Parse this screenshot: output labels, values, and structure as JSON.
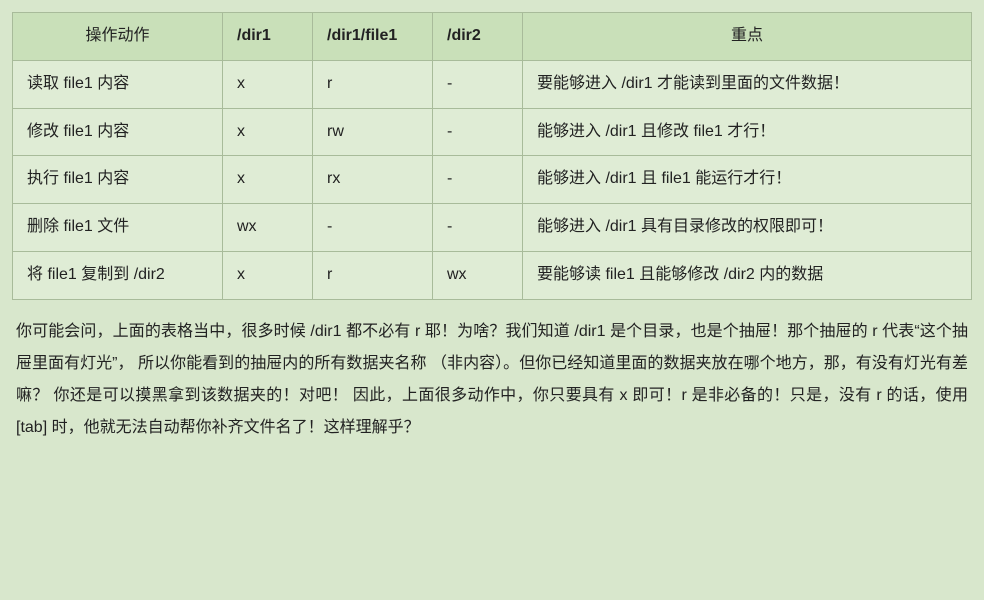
{
  "table": {
    "headers": [
      "操作动作",
      "/dir1",
      "/dir1/file1",
      "/dir2",
      "重点"
    ],
    "rows": [
      {
        "c0": "读取 file1 内容",
        "c1": "x",
        "c2": "r",
        "c3": "-",
        "c4": "要能够进入 /dir1 才能读到里面的文件数据！"
      },
      {
        "c0": "修改 file1 内容",
        "c1": "x",
        "c2": "rw",
        "c3": "-",
        "c4": "能够进入 /dir1 且修改 file1 才行！"
      },
      {
        "c0": "执行 file1 内容",
        "c1": "x",
        "c2": "rx",
        "c3": "-",
        "c4": "能够进入 /dir1 且 file1 能运行才行！"
      },
      {
        "c0": "删除 file1 文件",
        "c1": "wx",
        "c2": "-",
        "c3": "-",
        "c4": "能够进入 /dir1 具有目录修改的权限即可！"
      },
      {
        "c0": "将 file1 复制到 /dir2",
        "c1": "x",
        "c2": "r",
        "c3": "wx",
        "c4": "要能够读 file1 且能够修改 /dir2 内的数据"
      }
    ]
  },
  "paragraph": "你可能会问，上面的表格当中，很多时候 /dir1 都不必有 r 耶！为啥？我们知道 /dir1 是个目录，也是个抽屉！那个抽屉的 r 代表“这个抽屉里面有灯光”， 所以你能看到的抽屉内的所有数据夹名称 （非内容）。但你已经知道里面的数据夹放在哪个地方，那，有没有灯光有差嘛？ 你还是可以摸黑拿到该数据夹的！对吧！ 因此，上面很多动作中，你只要具有 x 即可！r 是非必备的！只是，没有 r 的话，使用 [tab] 时，他就无法自动帮你补齐文件名了！这样理解乎？"
}
